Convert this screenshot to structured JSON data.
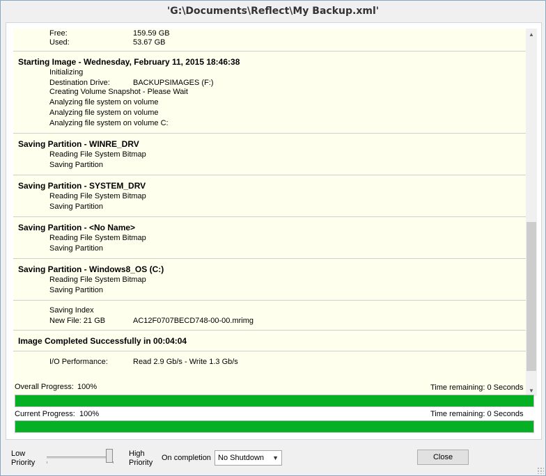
{
  "window": {
    "title": "'G:\\Documents\\Reflect\\My Backup.xml'"
  },
  "log": {
    "top": [
      {
        "label": "Free:",
        "value": "159.59 GB"
      },
      {
        "label": "Used:",
        "value": "53.67 GB"
      }
    ],
    "image_start": {
      "title": "Starting Image - Wednesday, February 11, 2015 18:46:38",
      "lines": [
        {
          "label": "Initializing",
          "value": ""
        },
        {
          "label": "Destination Drive:",
          "value": "BACKUPSIMAGES (F:)"
        },
        {
          "label": "Creating Volume Snapshot - Please Wait",
          "value": ""
        },
        {
          "label": "Analyzing file system on volume",
          "value": ""
        },
        {
          "label": "Analyzing file system on volume",
          "value": ""
        },
        {
          "label": "Analyzing file system on volume C:",
          "value": ""
        }
      ]
    },
    "partitions": [
      {
        "title": "Saving Partition - WINRE_DRV",
        "lines": [
          "Reading File System Bitmap",
          "Saving Partition"
        ]
      },
      {
        "title": "Saving Partition - SYSTEM_DRV",
        "lines": [
          "Reading File System Bitmap",
          "Saving Partition"
        ]
      },
      {
        "title": "Saving Partition - <No Name>",
        "lines": [
          "Reading File System Bitmap",
          "Saving Partition"
        ]
      },
      {
        "title": "Saving Partition - Windows8_OS (C:)",
        "lines": [
          "Reading File System Bitmap",
          "Saving Partition"
        ]
      }
    ],
    "index": {
      "lines": [
        {
          "label": "Saving Index",
          "value": ""
        },
        {
          "label": "New File: 21 GB",
          "value": "AC12F0707BECD748-00-00.mrimg"
        }
      ]
    },
    "completed": {
      "title": "Image Completed Successfully in 00:04:04"
    },
    "performance": {
      "label": "I/O Performance:",
      "value": "Read 2.9 Gb/s - Write 1.3 Gb/s"
    }
  },
  "progress": {
    "overall": {
      "label": "Overall Progress:",
      "percent_text": "100%",
      "remaining": "Time remaining: 0 Seconds",
      "value": 100
    },
    "current": {
      "label": "Current Progress:",
      "percent_text": "100%",
      "remaining": "Time remaining: 0 Seconds",
      "value": 100
    }
  },
  "footer": {
    "low_priority_1": "Low",
    "low_priority_2": "Priority",
    "high_priority_1": "High",
    "high_priority_2": "Priority",
    "priority_level": 100,
    "on_completion_label": "On completion",
    "on_completion_value": "No Shutdown",
    "close_label": "Close"
  },
  "colors": {
    "progress_fill": "#06b025",
    "log_background": "#ffffee"
  },
  "icons": {
    "scroll_up": "scroll-up-arrow-icon",
    "scroll_down": "scroll-down-arrow-icon",
    "dropdown": "chevron-down-icon",
    "grip": "resize-grip-icon"
  }
}
